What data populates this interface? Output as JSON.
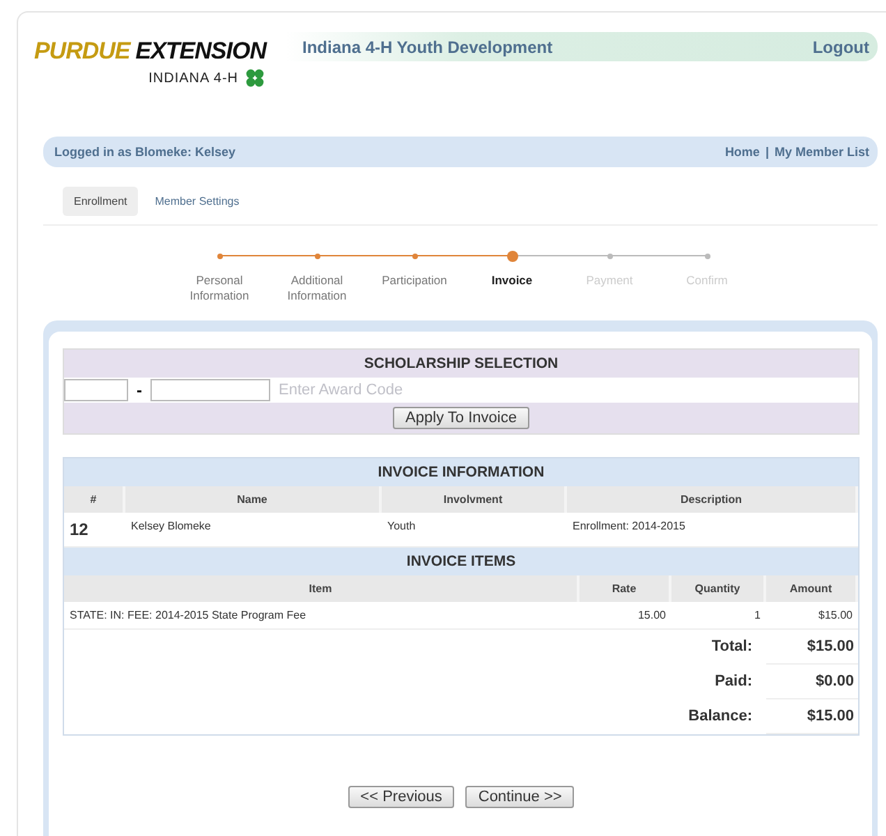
{
  "logo": {
    "brand": "PURDUE",
    "word": "EXTENSION",
    "sub": "INDIANA 4-H"
  },
  "header": {
    "title": "Indiana 4-H Youth Development",
    "logout": "Logout"
  },
  "user_bar": {
    "text": "Logged in as Blomeke: Kelsey",
    "links": [
      "Home",
      "My Member List"
    ],
    "separator": "|"
  },
  "tabs": [
    {
      "label": "Enrollment",
      "selected": true
    },
    {
      "label": "Member Settings",
      "selected": false
    }
  ],
  "steps": [
    {
      "label": "Personal Information",
      "completed": true,
      "selected": false
    },
    {
      "label": "Additional Information",
      "completed": true,
      "selected": false
    },
    {
      "label": "Participation",
      "completed": true,
      "selected": false
    },
    {
      "label": "Invoice",
      "completed": true,
      "selected": true
    },
    {
      "label": "Payment",
      "completed": false,
      "selected": false
    },
    {
      "label": "Confirm",
      "completed": false,
      "selected": false
    }
  ],
  "scholarship": {
    "title": "SCHOLARSHIP SELECTION",
    "dash": "-",
    "placeholder": "Enter Award Code",
    "button": "Apply To Invoice"
  },
  "invoice_info": {
    "title": "INVOICE INFORMATION",
    "columns": [
      "#",
      "Name",
      "Involvment",
      "Description"
    ],
    "rows": [
      [
        "12",
        "Kelsey Blomeke",
        "Youth",
        "Enrollment: 2014-2015"
      ]
    ]
  },
  "invoice_items": {
    "title": "INVOICE ITEMS",
    "columns": [
      "Item",
      "Rate",
      "Quantity",
      "Amount"
    ],
    "rows": [
      [
        "STATE: IN: FEE: 2014-2015 State Program Fee",
        "15.00",
        "1",
        "$15.00"
      ]
    ],
    "totals": [
      {
        "label": "Total:",
        "value": "$15.00"
      },
      {
        "label": "Paid:",
        "value": "$0.00"
      },
      {
        "label": "Balance:",
        "value": "$15.00"
      }
    ]
  },
  "buttons": [
    "<< Previous",
    "Continue >>"
  ]
}
